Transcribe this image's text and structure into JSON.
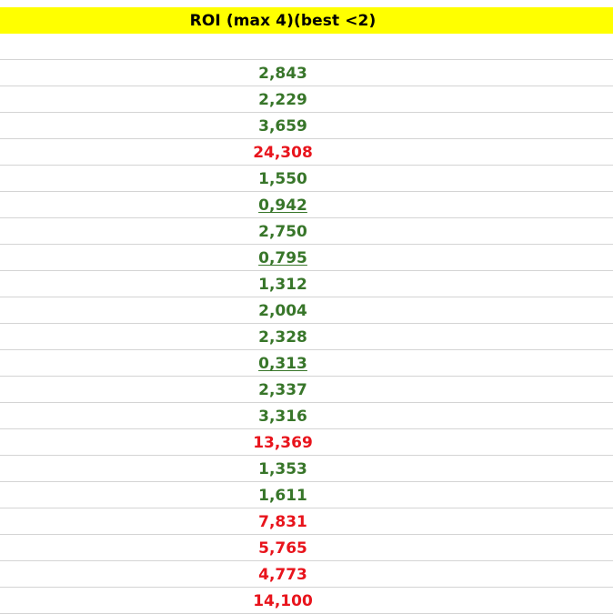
{
  "header": {
    "title": "ROI (max 4)(best <2)"
  },
  "colors": {
    "header_bg": "#ffff00",
    "good": "#38762a",
    "bad": "#e8141c"
  },
  "rows": [
    {
      "value": "2,843",
      "status": "good",
      "underline": false
    },
    {
      "value": "2,229",
      "status": "good",
      "underline": false
    },
    {
      "value": "3,659",
      "status": "good",
      "underline": false
    },
    {
      "value": "24,308",
      "status": "bad",
      "underline": false
    },
    {
      "value": "1,550",
      "status": "good",
      "underline": false
    },
    {
      "value": "0,942",
      "status": "good",
      "underline": true
    },
    {
      "value": "2,750",
      "status": "good",
      "underline": false
    },
    {
      "value": "0,795",
      "status": "good",
      "underline": true
    },
    {
      "value": "1,312",
      "status": "good",
      "underline": false
    },
    {
      "value": "2,004",
      "status": "good",
      "underline": false
    },
    {
      "value": "2,328",
      "status": "good",
      "underline": false
    },
    {
      "value": "0,313",
      "status": "good",
      "underline": true
    },
    {
      "value": "2,337",
      "status": "good",
      "underline": false
    },
    {
      "value": "3,316",
      "status": "good",
      "underline": false
    },
    {
      "value": "13,369",
      "status": "bad",
      "underline": false
    },
    {
      "value": "1,353",
      "status": "good",
      "underline": false
    },
    {
      "value": "1,611",
      "status": "good",
      "underline": false
    },
    {
      "value": "7,831",
      "status": "bad",
      "underline": false
    },
    {
      "value": "5,765",
      "status": "bad",
      "underline": false
    },
    {
      "value": "4,773",
      "status": "bad",
      "underline": false
    },
    {
      "value": "14,100",
      "status": "bad",
      "underline": false
    }
  ]
}
